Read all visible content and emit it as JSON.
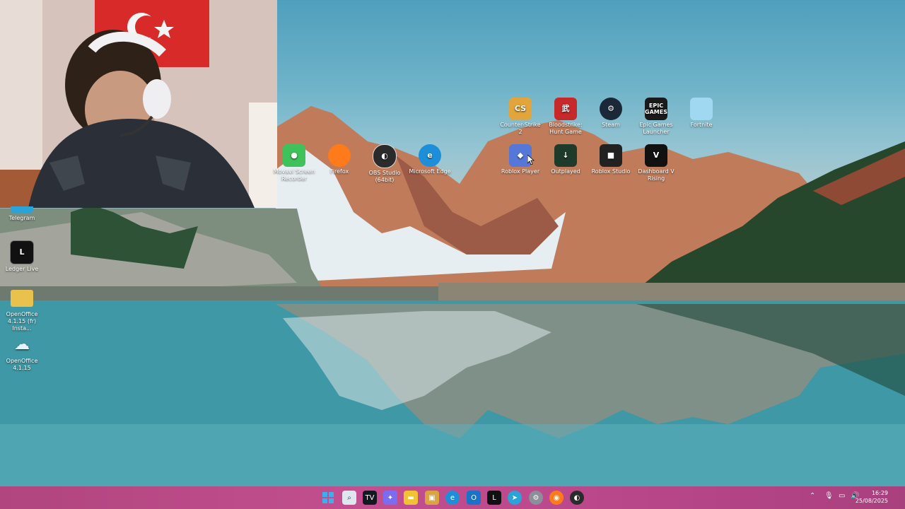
{
  "desktop_icons_left": [
    {
      "label": "Telegram",
      "icon": "telegram-icon",
      "color": "#2aa3d8"
    },
    {
      "label": "Ledger Live",
      "icon": "ledger-icon",
      "color": "#111111"
    },
    {
      "label": "OpenOffice 4.1.15 (fr) Insta...",
      "icon": "folder-icon",
      "color": "#e9c24d"
    },
    {
      "label": "OpenOffice 4.1.15",
      "icon": "openoffice-icon",
      "color": "#2e7fd0"
    }
  ],
  "desktop_icons_row1": [
    {
      "label": "Counter-Strike 2",
      "icon": "counter-strike-icon",
      "color": "#e1a53b"
    },
    {
      "label": "Bloodstrike: Hunt Game",
      "icon": "bloodstrike-icon",
      "color": "#c72828"
    },
    {
      "label": "Steam",
      "icon": "steam-icon",
      "color": "#1b2838"
    },
    {
      "label": "Epic Games Launcher",
      "icon": "epic-games-icon",
      "color": "#1a1a1a",
      "text": "EPIC GAMES"
    },
    {
      "label": "Fortnite",
      "icon": "fortnite-icon",
      "color": "#9fd8f0"
    }
  ],
  "desktop_icons_row2": [
    {
      "label": "Movavi Screen Recorder",
      "icon": "movavi-icon",
      "color": "#3fc25a"
    },
    {
      "label": "Firefox",
      "icon": "firefox-icon",
      "color": "#ff7a1a"
    },
    {
      "label": "OBS Studio (64bit)",
      "icon": "obs-icon",
      "color": "#2b2b2b"
    },
    {
      "label": "Microsoft Edge",
      "icon": "edge-icon",
      "color": "#1c8fd8"
    },
    {
      "label": "Roblox Player",
      "icon": "roblox-player-icon",
      "color": "#5577d8"
    },
    {
      "label": "Outplayed",
      "icon": "outplayed-icon",
      "color": "#1e3a2a"
    },
    {
      "label": "Roblox Studio",
      "icon": "roblox-studio-icon",
      "color": "#222222"
    },
    {
      "label": "Dashboard V Rising",
      "icon": "v-rising-icon",
      "color": "#111111"
    }
  ],
  "taskbar": {
    "apps": [
      {
        "name": "windows-start-icon",
        "color": "#3ab0f0"
      },
      {
        "name": "search-icon",
        "color": "#e0e6ee"
      },
      {
        "name": "tradingview-icon",
        "color": "#131722"
      },
      {
        "name": "copilot-icon",
        "color": "#7b6cf0"
      },
      {
        "name": "file-explorer-icon",
        "color": "#f1c232"
      },
      {
        "name": "store-icon",
        "color": "#d9a441"
      },
      {
        "name": "edge-icon",
        "color": "#1c8fd8"
      },
      {
        "name": "outlook-icon",
        "color": "#1a73c8"
      },
      {
        "name": "ledger-icon",
        "color": "#111111"
      },
      {
        "name": "telegram-icon",
        "color": "#2aa3d8"
      },
      {
        "name": "settings-icon",
        "color": "#8a8f99"
      },
      {
        "name": "firefox-icon",
        "color": "#ff7a1a"
      },
      {
        "name": "obs-icon",
        "color": "#2b2b2b"
      }
    ],
    "time": "16:29",
    "date": "25/08/2025"
  }
}
